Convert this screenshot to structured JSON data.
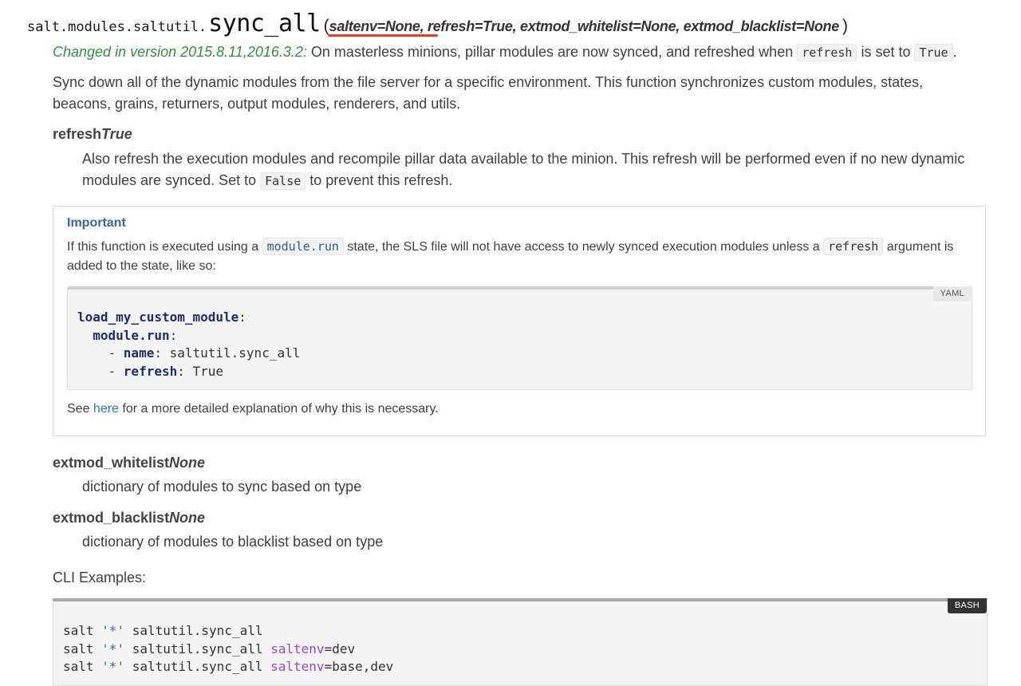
{
  "signature": {
    "prefix": "salt.modules.saltutil.",
    "name": "sync_all",
    "open_paren": "(",
    "params": "saltenv=None, refresh=True, extmod_whitelist=None, extmod_blacklist=None",
    "close_paren": ")"
  },
  "changed": {
    "label": "Changed in version 2015.8.11,2016.3.2:",
    "text_before": " On masterless minions, pillar modules are now synced, and refreshed when ",
    "code1": "refresh",
    "text_middle": " is set to ",
    "code2": "True",
    "text_after": "."
  },
  "description": "Sync down all of the dynamic modules from the file server for a specific environment. This function synchronizes custom modules, states, beacons, grains, returners, output modules, renderers, and utils.",
  "refresh_param": {
    "name": "refresh",
    "default": "True",
    "desc_before": "Also refresh the execution modules and recompile pillar data available to the minion. This refresh will be performed even if no new dynamic modules are synced. Set to ",
    "code": "False",
    "desc_after": " to prevent this refresh."
  },
  "important": {
    "title": "Important",
    "text_before": "If this function is executed using a ",
    "code1": "module.run",
    "text_middle": " state, the SLS file will not have access to newly synced execution modules unless a ",
    "code2": "refresh",
    "text_after": " argument is added to the state, like so:",
    "code_lang": "YAML",
    "yaml": {
      "l1_key": "load_my_custom_module",
      "l2_key": "module.run",
      "l3_key": "name",
      "l3_val": "saltutil.sync_all",
      "l4_key": "refresh",
      "l4_val": "True"
    },
    "see_before": "See ",
    "see_link": "here",
    "see_after": " for a more detailed explanation of why this is necessary."
  },
  "whitelist_param": {
    "name": "extmod_whitelist",
    "default": "None",
    "desc": "dictionary of modules to sync based on type"
  },
  "blacklist_param": {
    "name": "extmod_blacklist",
    "default": "None",
    "desc": "dictionary of modules to blacklist based on type"
  },
  "cli": {
    "label": "CLI Examples:",
    "lang": "BASH",
    "cmd": "salt",
    "target": "'*'",
    "func": "saltutil.sync_all",
    "arg_key": "saltenv",
    "arg_val2": "=dev",
    "arg_val3": "=base,dev"
  },
  "colors": {
    "changed": "#3a8a48",
    "link": "#2f78b7",
    "important_title": "#3a6591",
    "underline": "#d9412b"
  }
}
